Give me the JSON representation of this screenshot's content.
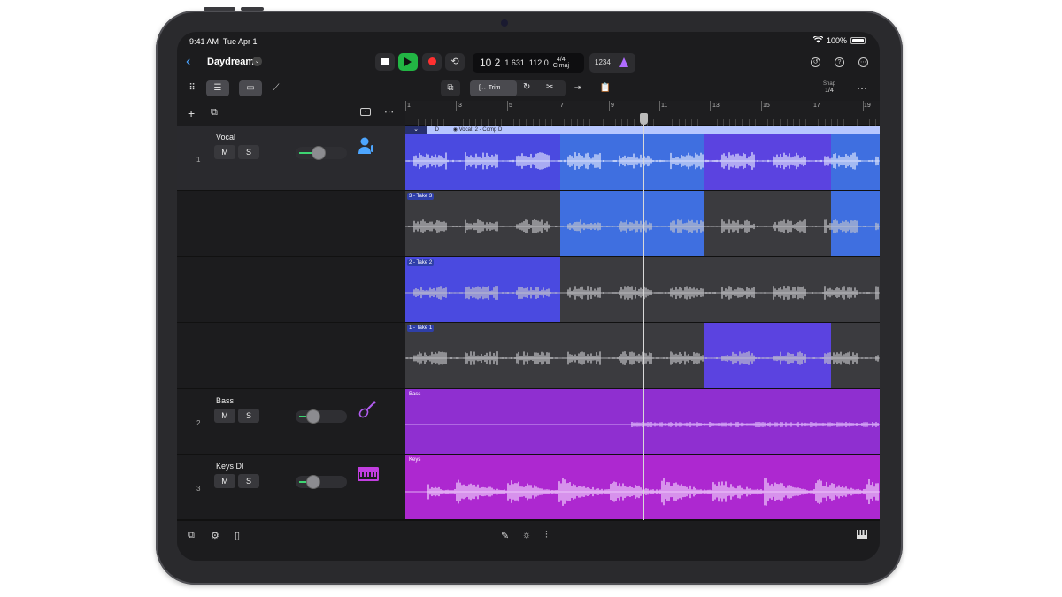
{
  "status_bar": {
    "time": "9:41 AM",
    "date": "Tue Apr 1",
    "battery": "100%"
  },
  "project": {
    "title": "Daydream"
  },
  "lcd": {
    "position": "10 2",
    "subposition": "1 631",
    "tempo": "112,0",
    "time_signature": "4/4",
    "key": "C maj"
  },
  "count_in": "1234",
  "toolbar": {
    "trim_label": "Trim",
    "snap_label": "Snap",
    "snap_value": "1/4"
  },
  "ruler": {
    "bars": [
      "1",
      "3",
      "5",
      "7",
      "9",
      "11",
      "13",
      "15",
      "17",
      "19"
    ]
  },
  "tracks": [
    {
      "number": "1",
      "name": "Vocal",
      "mute": "M",
      "solo": "S",
      "volume": 0.45,
      "icon": "singer-icon",
      "color": "#4a57e6"
    },
    {
      "number": "2",
      "name": "Bass",
      "mute": "M",
      "solo": "S",
      "volume": 0.35,
      "icon": "bass-guitar-icon",
      "color": "#9b2fd8"
    },
    {
      "number": "3",
      "name": "Keys DI",
      "mute": "M",
      "solo": "S",
      "volume": 0.35,
      "icon": "keyboard-icon",
      "color": "#b02fd0"
    }
  ],
  "comp": {
    "header_letter": "D",
    "header_title": "Vocal: 2 - Comp D"
  },
  "takes": [
    {
      "label": "3 - Take 3"
    },
    {
      "label": "2 - Take 2"
    },
    {
      "label": "1 - Take 1"
    }
  ],
  "regions": {
    "bass": "Bass",
    "keys": "Keys"
  }
}
